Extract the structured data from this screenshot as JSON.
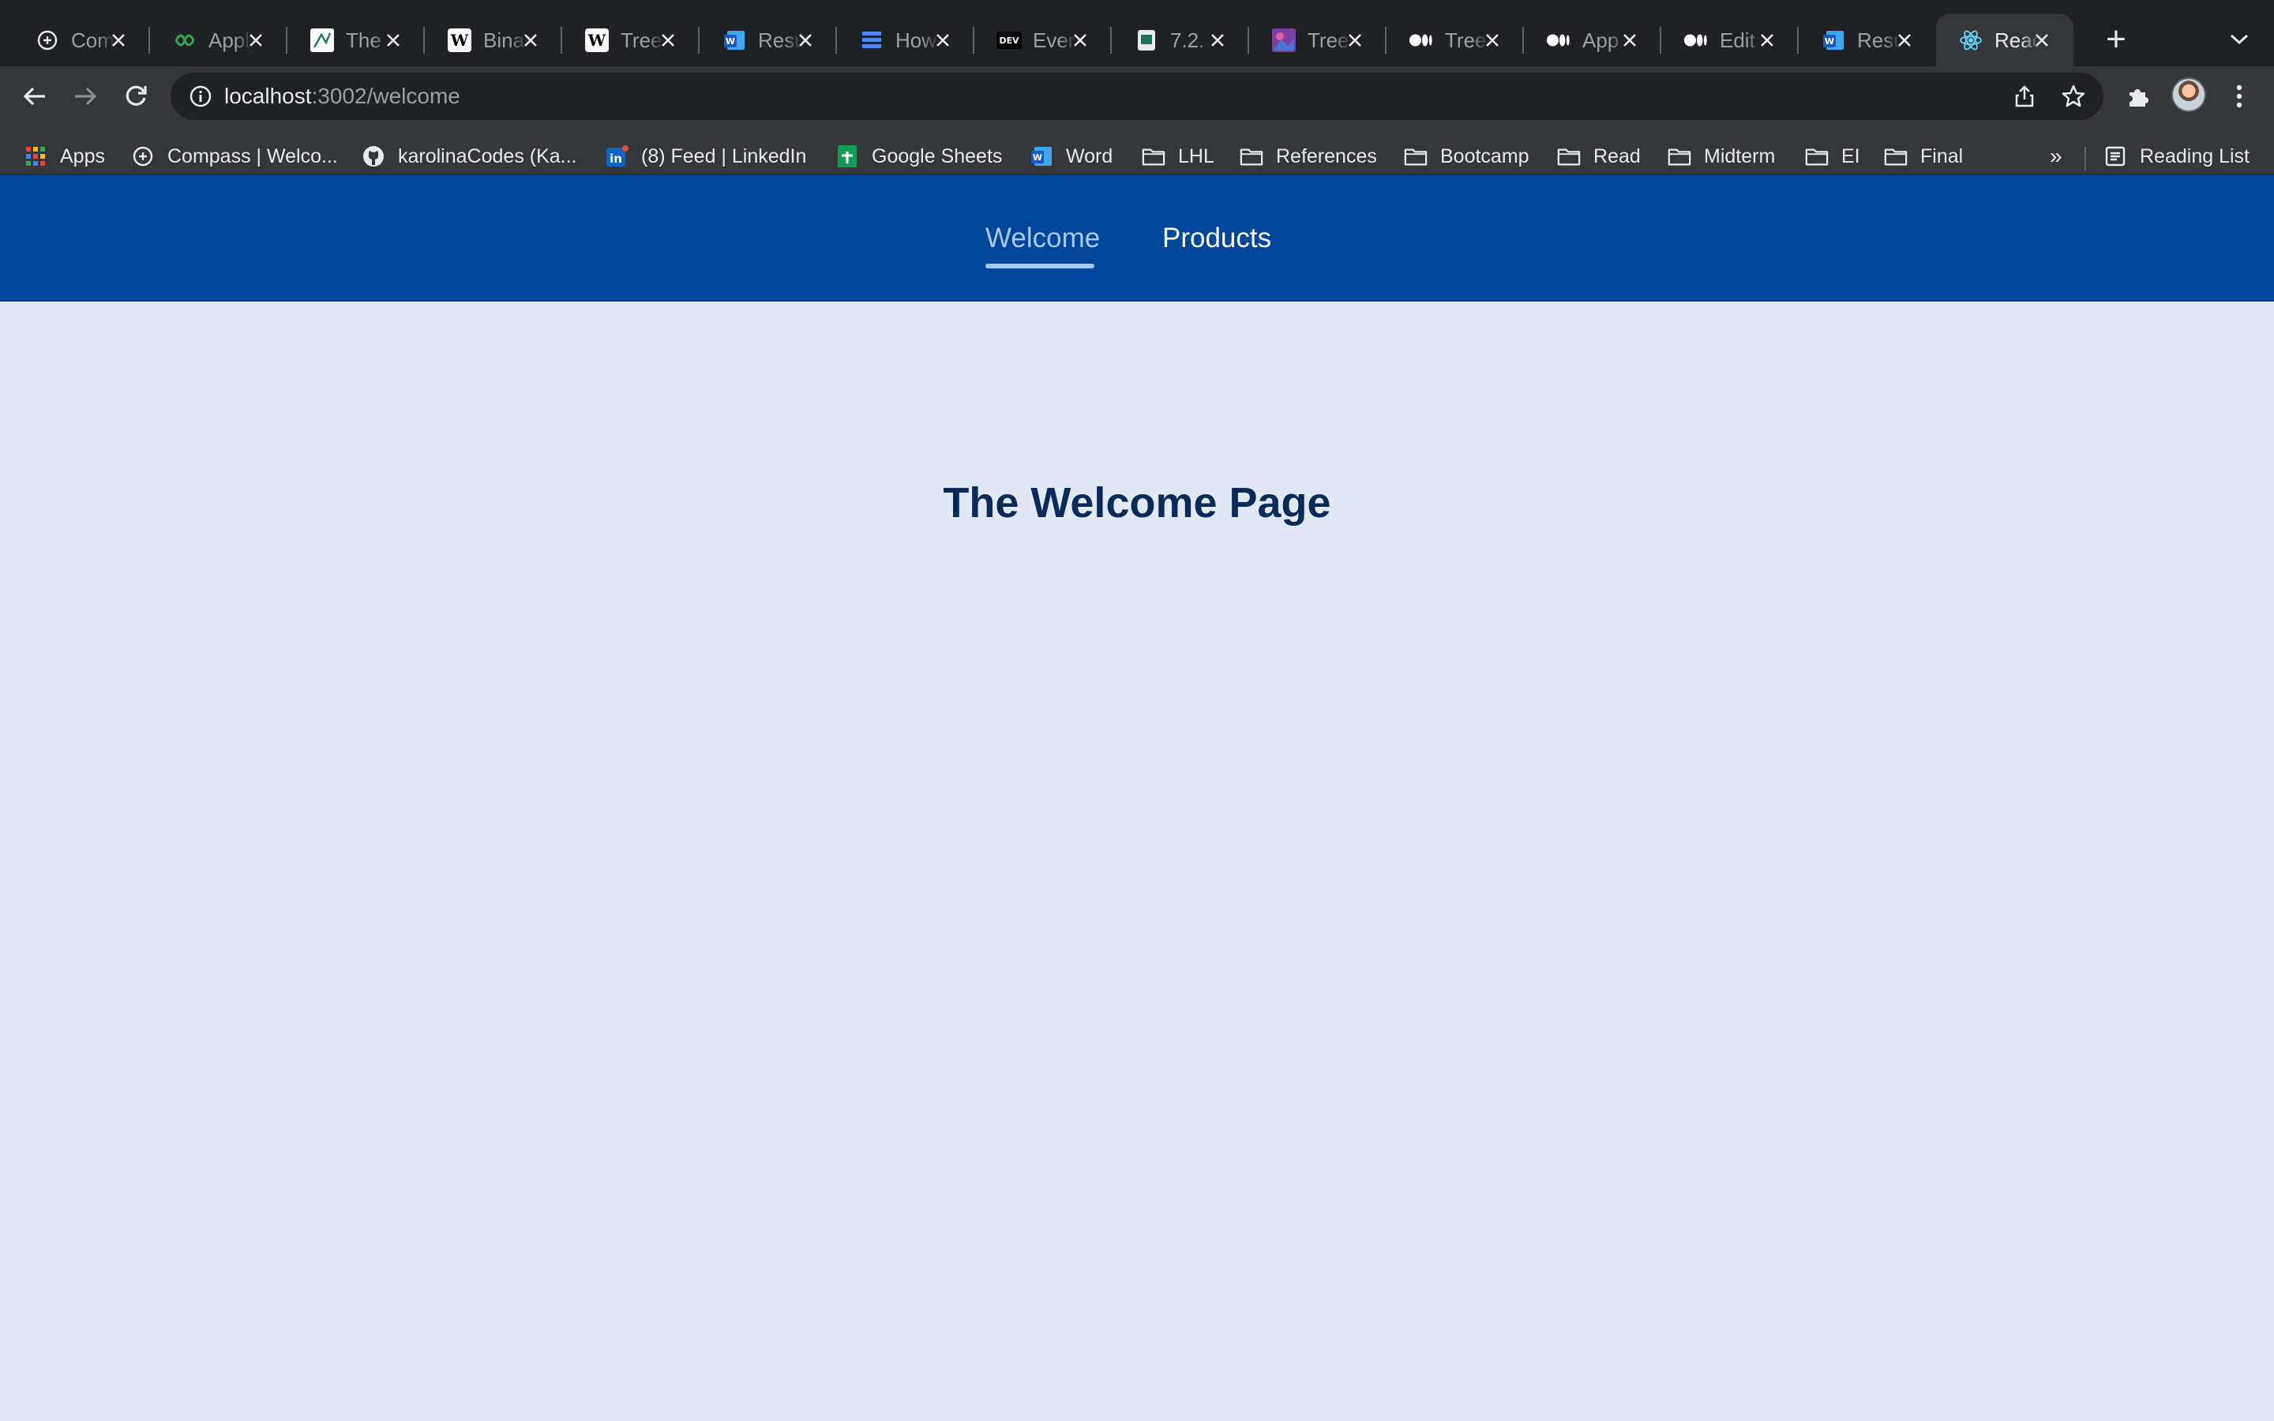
{
  "browser": {
    "tabs": [
      {
        "title": "Compass",
        "icon": "compass-icon",
        "color": "#2b2b2b"
      },
      {
        "title": "Apply",
        "icon": "link-icon",
        "color": "#202124"
      },
      {
        "title": "The",
        "icon": "sketch-icon",
        "color": "#ffffff"
      },
      {
        "title": "Binary",
        "icon": "wikipedia-icon",
        "color": "#ffffff"
      },
      {
        "title": "Tree",
        "icon": "wikipedia-icon",
        "color": "#ffffff"
      },
      {
        "title": "Resume",
        "icon": "word-icon",
        "color": "#185abd"
      },
      {
        "title": "How",
        "icon": "stack-icon",
        "color": "#3367d6"
      },
      {
        "title": "Every",
        "icon": "dev-icon",
        "color": "#000000"
      },
      {
        "title": "7.2.",
        "icon": "document-icon",
        "color": "#1e6e5a"
      },
      {
        "title": "Tree",
        "icon": "image-icon",
        "color": "#7a3fa0"
      },
      {
        "title": "Tree",
        "icon": "medium-icon",
        "color": "#000000"
      },
      {
        "title": "App",
        "icon": "medium-icon",
        "color": "#000000"
      },
      {
        "title": "Edit",
        "icon": "medium-icon",
        "color": "#000000"
      },
      {
        "title": "Resume",
        "icon": "word-icon",
        "color": "#185abd"
      },
      {
        "title": "React",
        "icon": "react-icon",
        "color": "#61dafb",
        "active": true
      }
    ],
    "new_tab_label": "+",
    "url_host": "localhost",
    "url_rest": ":3002/welcome",
    "bookmarks": [
      {
        "label": "Apps",
        "icon": "apps-grid-icon"
      },
      {
        "label": "Compass | Welco...",
        "icon": "compass-icon"
      },
      {
        "label": "karolinaCodes (Ka...",
        "icon": "github-icon"
      },
      {
        "label": "(8) Feed | LinkedIn",
        "icon": "linkedin-icon"
      },
      {
        "label": "Google Sheets",
        "icon": "sheets-icon"
      },
      {
        "label": "Word",
        "icon": "word-icon"
      },
      {
        "label": "LHL",
        "icon": "folder-icon"
      },
      {
        "label": "References",
        "icon": "folder-icon"
      },
      {
        "label": "Bootcamp",
        "icon": "folder-icon"
      },
      {
        "label": "Read",
        "icon": "folder-icon"
      },
      {
        "label": "Midterm",
        "icon": "folder-icon"
      },
      {
        "label": "EI",
        "icon": "folder-icon"
      },
      {
        "label": "Final",
        "icon": "folder-icon"
      }
    ],
    "bookmarks_overflow": "»",
    "reading_list": "Reading List"
  },
  "app": {
    "nav": {
      "welcome": "Welcome",
      "products": "Products"
    },
    "heading": "The Welcome Page"
  },
  "colors": {
    "nav_bg": "#00479c",
    "page_bg": "#e2e9f5",
    "active_link": "#a9c8f3",
    "heading": "#0a2a5c"
  }
}
